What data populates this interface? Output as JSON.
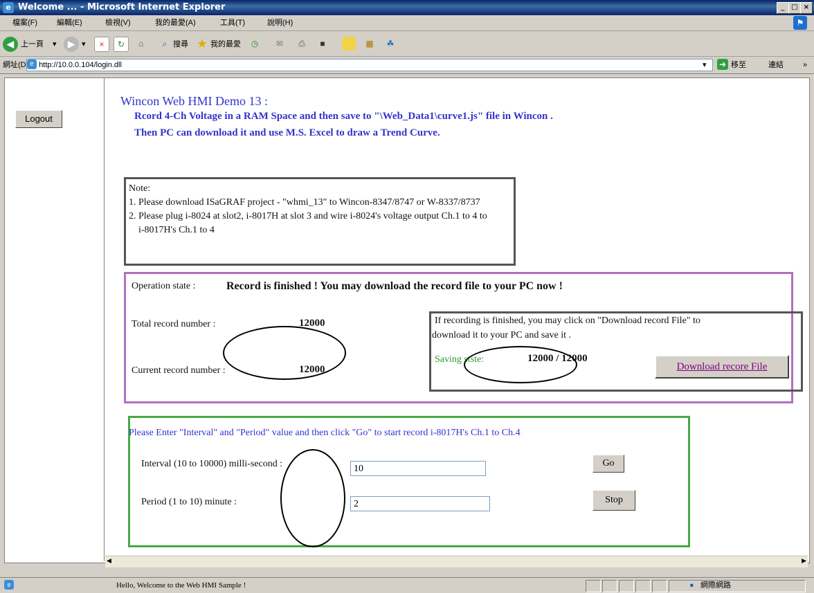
{
  "window": {
    "title": "Welcome ... - Microsoft Internet Explorer"
  },
  "menu": [
    "檔案(F)",
    "編輯(E)",
    "檢視(V)",
    "我的最愛(A)",
    "工具(T)",
    "說明(H)"
  ],
  "toolbar": {
    "back_label": "上一頁",
    "search_label": "搜尋",
    "favorites_label": "我的最愛"
  },
  "address": {
    "label": "網址(D)",
    "url": "http://10.0.0.104/login.dll",
    "go_label": "移至",
    "links_label": "連結"
  },
  "left": {
    "logout_label": "Logout"
  },
  "header": {
    "title": "Wincon Web HMI Demo 13 :",
    "line1": "Rcord 4-Ch Voltage in  a RAM  Space and then save to \"\\Web_Data1\\curve1.js\" file in Wincon .",
    "line2": "Then PC can download it and use M.S. Excel to draw a Trend Curve."
  },
  "note": {
    "title": "Note:",
    "item1": "1. Please download ISaGRAF project - \"whmi_13\" to Wincon-8347/8747 or W-8337/8737",
    "item2a": "2. Please plug i-8024 at slot2, i-8017H at slot 3 and wire i-8024's voltage output Ch.1 to 4 to",
    "item2b": "i-8017H's Ch.1 to 4"
  },
  "operation": {
    "state_label": "Operation state :",
    "state_value": "Record is finished ! You may download the record file to your PC now !",
    "total_label": "Total record number :",
    "total_value": "12000",
    "current_label": "Current record number :",
    "current_value": "12000"
  },
  "download": {
    "text1": "If recording is finished, you may click on \"Download record File\" to",
    "text2": "download it to your PC and save it .",
    "saving_label": "Saving stste:",
    "saving_value": "12000 / 12000",
    "button_label": "Download recore File"
  },
  "form": {
    "instruction": "Please Enter \"Interval\" and \"Period\" value and then click \"Go\" to start record i-8017H's Ch.1 to Ch.4",
    "interval_label": "Interval  (10 to 10000) milli-second :",
    "interval_value": "10",
    "go_label": "Go",
    "period_label": "Period (1 to 10) minute :",
    "period_value": "2",
    "stop_label": "Stop"
  },
  "status": {
    "message": "Hello, Welcome to the Web HMI Sample !",
    "zone": "網際網路"
  }
}
